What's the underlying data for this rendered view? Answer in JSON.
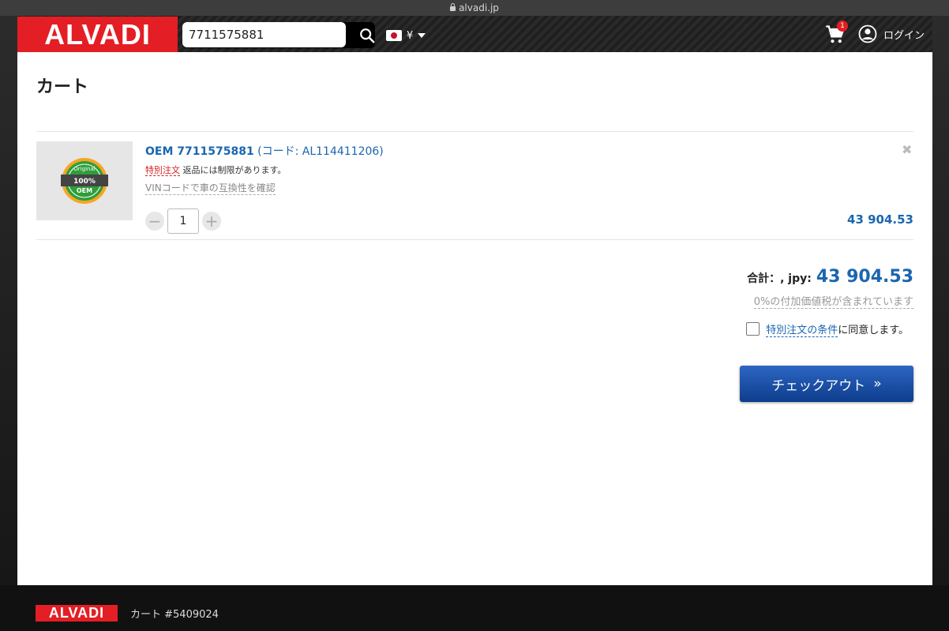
{
  "browser": {
    "url": "alvadi.jp"
  },
  "header": {
    "logo": "ALVADI",
    "search_value": "7711575881",
    "currency_symbol": "¥",
    "cart_count": "1",
    "login_label": "ログイン"
  },
  "page": {
    "title": "カート"
  },
  "cart_item": {
    "title_strong": "OEM 7711575881",
    "title_code": " (コード: AL114411206)",
    "special_label": "特別注文",
    "special_note": " 返品には制限があります。",
    "vin_check": "VINコードで車の互換性を確認",
    "quantity": "1",
    "price": "43 904.53",
    "badge": {
      "top": "Original",
      "middle": "100%",
      "bottom": "OEM"
    }
  },
  "summary": {
    "total_label": "合計：, jpy:",
    "total_value": "43 904.53",
    "vat_note": "0%の付加価値税が含まれています",
    "terms_link": "特別注文の条件",
    "terms_suffix": "に同意します。",
    "checkout_label": "チェックアウト",
    "checkout_arrow": "»"
  },
  "footer": {
    "logo": "ALVADI",
    "cart_ref": "カート #5409024"
  },
  "colors": {
    "brand_red": "#e31e24",
    "link_blue": "#1a66b0",
    "checkout_blue": "#0d3d8c"
  }
}
